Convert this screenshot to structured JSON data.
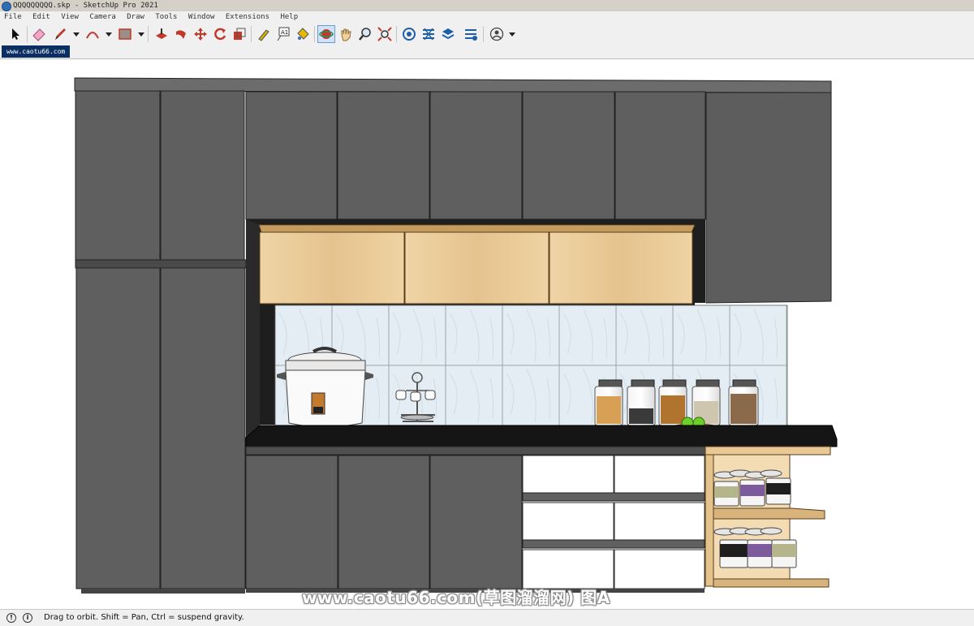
{
  "window": {
    "title": "QQQQQQQQQ.skp - SketchUp Pro 2021"
  },
  "menu": [
    "File",
    "Edit",
    "View",
    "Camera",
    "Draw",
    "Tools",
    "Window",
    "Extensions",
    "Help"
  ],
  "toolbar": {
    "buttons": [
      {
        "name": "select-tool",
        "icon": "arrow-cursor-icon"
      },
      {
        "name": "eraser-tool",
        "icon": "eraser-icon"
      },
      {
        "name": "line-tool",
        "icon": "pencil-icon"
      },
      {
        "name": "arc-tool",
        "icon": "arc-icon"
      },
      {
        "name": "shapes-tool",
        "icon": "rectangle-icon"
      },
      {
        "name": "push-pull-tool",
        "icon": "push-pull-icon"
      },
      {
        "name": "follow-me-tool",
        "icon": "follow-me-icon"
      },
      {
        "name": "move-tool",
        "icon": "move-icon"
      },
      {
        "name": "rotate-tool",
        "icon": "rotate-icon"
      },
      {
        "name": "scale-tool",
        "icon": "scale-icon"
      },
      {
        "name": "tape-measure-tool",
        "icon": "tape-measure-icon"
      },
      {
        "name": "text-tool",
        "icon": "text-icon"
      },
      {
        "name": "paint-bucket-tool",
        "icon": "paint-bucket-icon"
      },
      {
        "name": "orbit-tool",
        "icon": "orbit-icon",
        "active": true
      },
      {
        "name": "pan-tool",
        "icon": "hand-icon"
      },
      {
        "name": "zoom-tool",
        "icon": "magnifier-icon"
      },
      {
        "name": "zoom-extents-tool",
        "icon": "zoom-extents-icon"
      },
      {
        "name": "warehouse-tool",
        "icon": "warehouse-icon"
      },
      {
        "name": "extension-warehouse-tool",
        "icon": "extension-warehouse-icon"
      },
      {
        "name": "trimble-connect-tool",
        "icon": "layers-icon"
      },
      {
        "name": "extension-manager-tool",
        "icon": "extension-manager-icon"
      },
      {
        "name": "account-tool",
        "icon": "user-icon"
      }
    ]
  },
  "tab": {
    "label": "www.caotu66.com"
  },
  "scene": {
    "watermark": "www.caotu66.com(草图溜溜网) 图A"
  },
  "status": {
    "text": "Drag to orbit. Shift = Pan, Ctrl = suspend gravity."
  },
  "colors": {
    "cabinet": "#5f5f5f",
    "cabinet_dark": "#404040",
    "wood": "#e8c895",
    "countertop": "#1a1a1a",
    "tile": "#e3edf3",
    "active_tool": "#cfe2f7"
  }
}
